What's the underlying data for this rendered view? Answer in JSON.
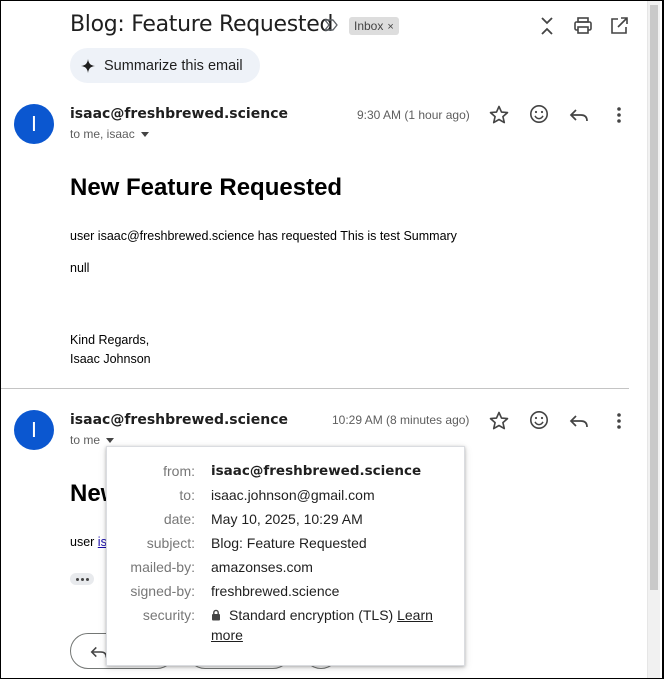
{
  "header": {
    "subject": "Blog: Feature Requested",
    "chip_label": "Inbox",
    "chip_close": "×",
    "summarize_label": "Summarize this email"
  },
  "messages": [
    {
      "avatar_letter": "I",
      "sender": "isaac@freshbrewed.science",
      "to_line": "to me, isaac",
      "time": "9:30 AM (1 hour ago)",
      "heading": "New Feature Requested",
      "line1": "user isaac@freshbrewed.science has requested This is test Summary",
      "line2": "null",
      "signoff1": "Kind Regards,",
      "signoff2": "Isaac Johnson"
    },
    {
      "avatar_letter": "I",
      "sender": "isaac@freshbrewed.science",
      "to_line": "to me",
      "time": "10:29 AM (8 minutes ago)",
      "heading_partial": "New",
      "line1_prefix": "user ",
      "line1_link": "is"
    }
  ],
  "details_popup": {
    "from_label": "from:",
    "from_value": "isaac@freshbrewed.science",
    "to_label": "to:",
    "to_value": "isaac.johnson@gmail.com",
    "date_label": "date:",
    "date_value": "May 10, 2025, 10:29 AM",
    "subject_label": "subject:",
    "subject_value": "Blog: Feature Requested",
    "mailedby_label": "mailed-by:",
    "mailedby_value": "amazonses.com",
    "signedby_label": "signed-by:",
    "signedby_value": "freshbrewed.science",
    "security_label": "security:",
    "security_value": "Standard encryption (TLS)",
    "learn_more_1": "Learn",
    "learn_more_2": "more"
  },
  "icons": {
    "label_arrow": "label-important-icon",
    "close_all": "collapse-icon",
    "print": "print-icon",
    "open_new": "open-in-new-window-icon",
    "sparkle": "sparkle-icon",
    "star": "star-icon",
    "emoji": "emoji-reaction-icon",
    "reply": "reply-icon",
    "more": "more-vertical-icon",
    "lock": "lock-icon"
  },
  "colors": {
    "avatar": "#0b57d0",
    "summarize_bg": "#eef2f8",
    "link": "#1a0dab"
  }
}
